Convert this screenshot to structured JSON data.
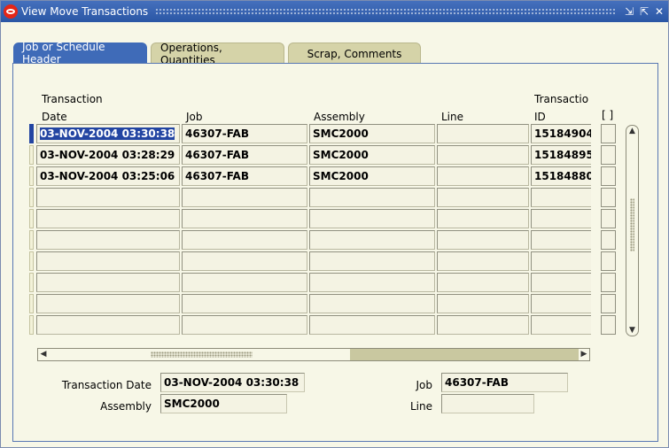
{
  "window": {
    "title": "View Move Transactions",
    "controls": {
      "minimize": "⇲",
      "maximize": "⇱",
      "close": "✕"
    }
  },
  "tabs": [
    {
      "label": "Job or Schedule Header",
      "active": true
    },
    {
      "label": "Operations, Quantities",
      "active": false
    },
    {
      "label": "Scrap, Comments",
      "active": false
    }
  ],
  "columns": {
    "transaction_date_line1": "Transaction",
    "transaction_date_line2": "Date",
    "job": "Job",
    "assembly": "Assembly",
    "line": "Line",
    "transaction_id_line1": "Transactio",
    "transaction_id_line2": "ID",
    "flex": "[ ]"
  },
  "rows": [
    {
      "date": "03-NOV-2004 03:30:38",
      "job": "46307-FAB",
      "assembly": "SMC2000",
      "line": "",
      "id": "15184904",
      "selected": true
    },
    {
      "date": "03-NOV-2004 03:28:29",
      "job": "46307-FAB",
      "assembly": "SMC2000",
      "line": "",
      "id": "15184895",
      "selected": false
    },
    {
      "date": "03-NOV-2004 03:25:06",
      "job": "46307-FAB",
      "assembly": "SMC2000",
      "line": "",
      "id": "15184880",
      "selected": false
    },
    {
      "date": "",
      "job": "",
      "assembly": "",
      "line": "",
      "id": "",
      "selected": false
    },
    {
      "date": "",
      "job": "",
      "assembly": "",
      "line": "",
      "id": "",
      "selected": false
    },
    {
      "date": "",
      "job": "",
      "assembly": "",
      "line": "",
      "id": "",
      "selected": false
    },
    {
      "date": "",
      "job": "",
      "assembly": "",
      "line": "",
      "id": "",
      "selected": false
    },
    {
      "date": "",
      "job": "",
      "assembly": "",
      "line": "",
      "id": "",
      "selected": false
    },
    {
      "date": "",
      "job": "",
      "assembly": "",
      "line": "",
      "id": "",
      "selected": false
    },
    {
      "date": "",
      "job": "",
      "assembly": "",
      "line": "",
      "id": "",
      "selected": false
    }
  ],
  "detail": {
    "transaction_date_label": "Transaction Date",
    "transaction_date_value": "03-NOV-2004 03:30:38",
    "assembly_label": "Assembly",
    "assembly_value": "SMC2000",
    "job_label": "Job",
    "job_value": "46307-FAB",
    "line_label": "Line",
    "line_value": ""
  },
  "scroll": {
    "up": "▲",
    "down": "▼",
    "left": "◀",
    "right": "▶"
  },
  "colors": {
    "accent": "#3f6bb8",
    "title_bar": "#2b57a7",
    "background": "#f7f7e7",
    "tab_inactive": "#d5d3a8"
  }
}
